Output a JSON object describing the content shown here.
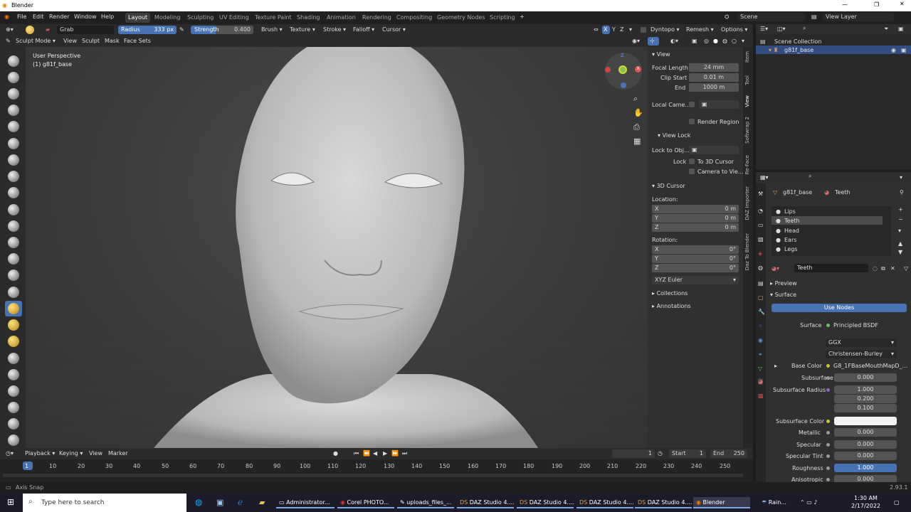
{
  "window": {
    "title": "Blender"
  },
  "menubar": {
    "items": [
      "File",
      "Edit",
      "Render",
      "Window",
      "Help"
    ],
    "workspaces": [
      "Layout",
      "Modeling",
      "Sculpting",
      "UV Editing",
      "Texture Paint",
      "Shading",
      "Animation",
      "Rendering",
      "Compositing",
      "Geometry Nodes",
      "Scripting"
    ],
    "active_workspace": "Layout",
    "scene": "Scene",
    "view_layer": "View Layer"
  },
  "toolheader": {
    "brush": "Grab",
    "radius_label": "Radius",
    "radius_value": "333 px",
    "strength_label": "Strength",
    "strength_value": "0.400",
    "menus": [
      "Brush",
      "Texture",
      "Stroke",
      "Falloff",
      "Cursor"
    ],
    "axes": [
      "X",
      "Y",
      "Z"
    ],
    "dyntopo": "Dyntopo",
    "remesh": "Remesh",
    "options": "Options"
  },
  "modeheader": {
    "mode": "Sculpt Mode",
    "menus": [
      "View",
      "Sculpt",
      "Mask",
      "Face Sets"
    ]
  },
  "viewport": {
    "perspective": "User Perspective",
    "object": "(1) g81f_base"
  },
  "npanel": {
    "view_header": "View",
    "focal_label": "Focal Length",
    "focal": "24 mm",
    "clip_start_label": "Clip Start",
    "clip_start": "0.01 m",
    "end_label": "End",
    "end": "1000 m",
    "local_camera": "Local Came...",
    "render_region": "Render Region",
    "view_lock": "View Lock",
    "lock_to_obj": "Lock to Obj...",
    "lock": "Lock",
    "to_3d_cursor": "To 3D Cursor",
    "camera_to_view": "Camera to Vie...",
    "cursor_header": "3D Cursor",
    "location": "Location:",
    "rotation": "Rotation:",
    "loc": [
      {
        "axis": "X",
        "val": "0 m"
      },
      {
        "axis": "Y",
        "val": "0 m"
      },
      {
        "axis": "Z",
        "val": "0 m"
      }
    ],
    "rot": [
      {
        "axis": "X",
        "val": "0°"
      },
      {
        "axis": "Y",
        "val": "0°"
      },
      {
        "axis": "Z",
        "val": "0°"
      }
    ],
    "rot_mode": "XYZ Euler",
    "collections": "Collections",
    "annotations": "Annotations"
  },
  "vtabs": [
    "Item",
    "Tool",
    "View",
    "Softwrap 2",
    "Re-Face",
    "DAZ Importer",
    "Daz To Blender"
  ],
  "outliner": {
    "root": "Scene Collection",
    "item": "g81f_base"
  },
  "properties": {
    "object": "g81f_base",
    "material_context": "Teeth",
    "slots": [
      "Lips",
      "Teeth",
      "Head",
      "Ears",
      "Legs"
    ],
    "active_slot": "Teeth",
    "material": "Teeth",
    "preview": "Preview",
    "surface_header": "Surface",
    "use_nodes": "Use Nodes",
    "surface_label": "Surface",
    "surface": "Principled BSDF",
    "distribution": "GGX",
    "sss_method": "Christensen-Burley",
    "base_color_label": "Base Color",
    "base_color": "G8_1FBaseMouthMapD_...",
    "rows": [
      {
        "label": "Subsurface",
        "val": "0.000"
      },
      {
        "label": "Subsurface Radius",
        "val": "1.000"
      },
      {
        "label": "",
        "val": "0.200"
      },
      {
        "label": "",
        "val": "0.100"
      }
    ],
    "sss_color_label": "Subsurface Color",
    "rows2": [
      {
        "label": "Metallic",
        "val": "0.000"
      },
      {
        "label": "Specular",
        "val": "0.000"
      },
      {
        "label": "Specular Tint",
        "val": "0.000"
      },
      {
        "label": "Roughness",
        "val": "1.000"
      },
      {
        "label": "Anisotropic",
        "val": "0.000"
      }
    ]
  },
  "timeline": {
    "menus": [
      "Playback",
      "Keying",
      "View",
      "Marker"
    ],
    "current": "1",
    "start_label": "Start",
    "start": "1",
    "end_label": "End",
    "end": "250",
    "ticks": [
      "1",
      "10",
      "20",
      "30",
      "40",
      "50",
      "60",
      "70",
      "80",
      "90",
      "100",
      "110",
      "120",
      "130",
      "140",
      "150",
      "160",
      "170",
      "180",
      "190",
      "200",
      "210",
      "220",
      "230",
      "240",
      "250"
    ]
  },
  "status": {
    "left": "Axis Snap",
    "version": "2.93.1"
  },
  "taskbar": {
    "search": "Type here to search",
    "apps": [
      "Administrator...",
      "Corel PHOTO...",
      "uploads_files_...",
      "DAZ Studio 4....",
      "DAZ Studio 4....",
      "DAZ Studio 4....",
      "DAZ Studio 4....",
      "Blender"
    ],
    "weather": "Rain...",
    "time": "1:30 AM",
    "date": "2/17/2022"
  }
}
